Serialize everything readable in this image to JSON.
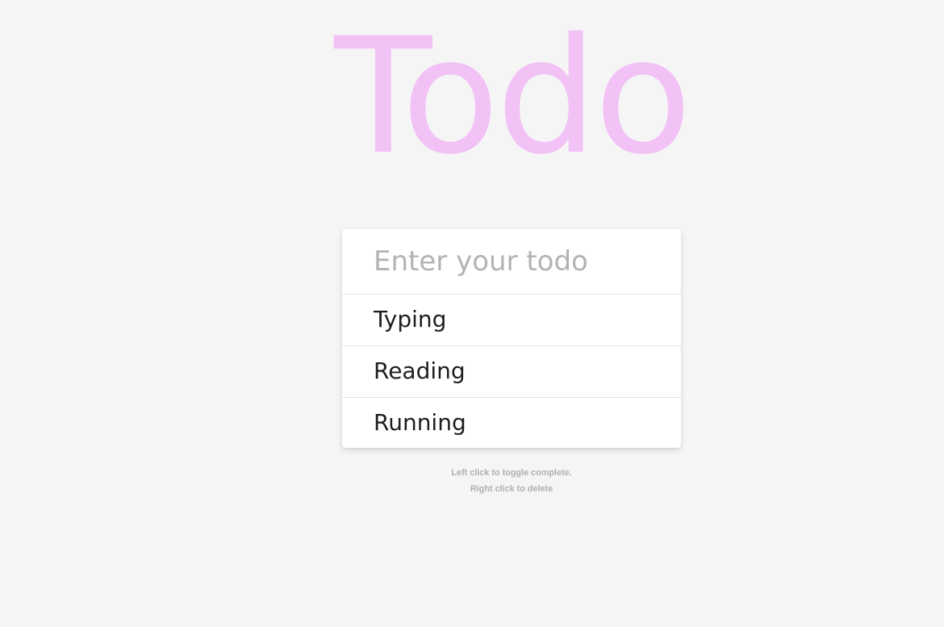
{
  "app": {
    "title": "Todo"
  },
  "input": {
    "placeholder": "Enter your todo",
    "value": ""
  },
  "todos": [
    {
      "label": "Typing"
    },
    {
      "label": "Reading"
    },
    {
      "label": "Running"
    }
  ],
  "hint": {
    "line1": "Left click to toggle complete.",
    "line2": "Right click to delete"
  },
  "colors": {
    "title": "#f2c1f5",
    "background": "#f5f5f5",
    "card": "#ffffff",
    "placeholder": "#b3b3b3",
    "hint": "#b0b0b0"
  }
}
